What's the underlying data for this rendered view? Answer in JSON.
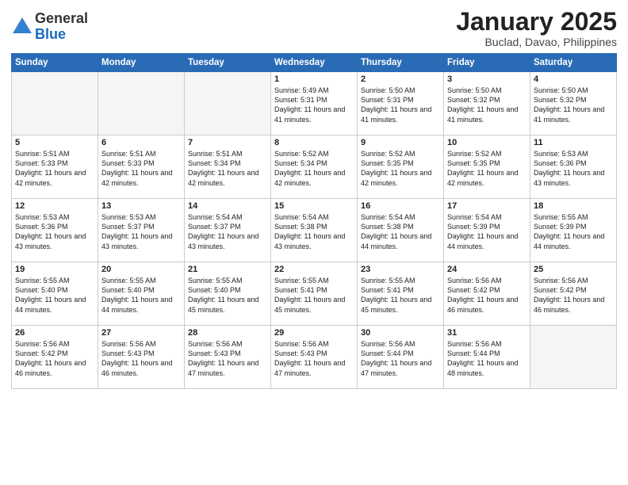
{
  "logo": {
    "general": "General",
    "blue": "Blue"
  },
  "title": "January 2025",
  "subtitle": "Buclad, Davao, Philippines",
  "headers": [
    "Sunday",
    "Monday",
    "Tuesday",
    "Wednesday",
    "Thursday",
    "Friday",
    "Saturday"
  ],
  "weeks": [
    [
      {
        "day": "",
        "empty": true
      },
      {
        "day": "",
        "empty": true
      },
      {
        "day": "",
        "empty": true
      },
      {
        "day": "1",
        "sunrise": "Sunrise: 5:49 AM",
        "sunset": "Sunset: 5:31 PM",
        "daylight": "Daylight: 11 hours and 41 minutes."
      },
      {
        "day": "2",
        "sunrise": "Sunrise: 5:50 AM",
        "sunset": "Sunset: 5:31 PM",
        "daylight": "Daylight: 11 hours and 41 minutes."
      },
      {
        "day": "3",
        "sunrise": "Sunrise: 5:50 AM",
        "sunset": "Sunset: 5:32 PM",
        "daylight": "Daylight: 11 hours and 41 minutes."
      },
      {
        "day": "4",
        "sunrise": "Sunrise: 5:50 AM",
        "sunset": "Sunset: 5:32 PM",
        "daylight": "Daylight: 11 hours and 41 minutes."
      }
    ],
    [
      {
        "day": "5",
        "sunrise": "Sunrise: 5:51 AM",
        "sunset": "Sunset: 5:33 PM",
        "daylight": "Daylight: 11 hours and 42 minutes."
      },
      {
        "day": "6",
        "sunrise": "Sunrise: 5:51 AM",
        "sunset": "Sunset: 5:33 PM",
        "daylight": "Daylight: 11 hours and 42 minutes."
      },
      {
        "day": "7",
        "sunrise": "Sunrise: 5:51 AM",
        "sunset": "Sunset: 5:34 PM",
        "daylight": "Daylight: 11 hours and 42 minutes."
      },
      {
        "day": "8",
        "sunrise": "Sunrise: 5:52 AM",
        "sunset": "Sunset: 5:34 PM",
        "daylight": "Daylight: 11 hours and 42 minutes."
      },
      {
        "day": "9",
        "sunrise": "Sunrise: 5:52 AM",
        "sunset": "Sunset: 5:35 PM",
        "daylight": "Daylight: 11 hours and 42 minutes."
      },
      {
        "day": "10",
        "sunrise": "Sunrise: 5:52 AM",
        "sunset": "Sunset: 5:35 PM",
        "daylight": "Daylight: 11 hours and 42 minutes."
      },
      {
        "day": "11",
        "sunrise": "Sunrise: 5:53 AM",
        "sunset": "Sunset: 5:36 PM",
        "daylight": "Daylight: 11 hours and 43 minutes."
      }
    ],
    [
      {
        "day": "12",
        "sunrise": "Sunrise: 5:53 AM",
        "sunset": "Sunset: 5:36 PM",
        "daylight": "Daylight: 11 hours and 43 minutes."
      },
      {
        "day": "13",
        "sunrise": "Sunrise: 5:53 AM",
        "sunset": "Sunset: 5:37 PM",
        "daylight": "Daylight: 11 hours and 43 minutes."
      },
      {
        "day": "14",
        "sunrise": "Sunrise: 5:54 AM",
        "sunset": "Sunset: 5:37 PM",
        "daylight": "Daylight: 11 hours and 43 minutes."
      },
      {
        "day": "15",
        "sunrise": "Sunrise: 5:54 AM",
        "sunset": "Sunset: 5:38 PM",
        "daylight": "Daylight: 11 hours and 43 minutes."
      },
      {
        "day": "16",
        "sunrise": "Sunrise: 5:54 AM",
        "sunset": "Sunset: 5:38 PM",
        "daylight": "Daylight: 11 hours and 44 minutes."
      },
      {
        "day": "17",
        "sunrise": "Sunrise: 5:54 AM",
        "sunset": "Sunset: 5:39 PM",
        "daylight": "Daylight: 11 hours and 44 minutes."
      },
      {
        "day": "18",
        "sunrise": "Sunrise: 5:55 AM",
        "sunset": "Sunset: 5:39 PM",
        "daylight": "Daylight: 11 hours and 44 minutes."
      }
    ],
    [
      {
        "day": "19",
        "sunrise": "Sunrise: 5:55 AM",
        "sunset": "Sunset: 5:40 PM",
        "daylight": "Daylight: 11 hours and 44 minutes."
      },
      {
        "day": "20",
        "sunrise": "Sunrise: 5:55 AM",
        "sunset": "Sunset: 5:40 PM",
        "daylight": "Daylight: 11 hours and 44 minutes."
      },
      {
        "day": "21",
        "sunrise": "Sunrise: 5:55 AM",
        "sunset": "Sunset: 5:40 PM",
        "daylight": "Daylight: 11 hours and 45 minutes."
      },
      {
        "day": "22",
        "sunrise": "Sunrise: 5:55 AM",
        "sunset": "Sunset: 5:41 PM",
        "daylight": "Daylight: 11 hours and 45 minutes."
      },
      {
        "day": "23",
        "sunrise": "Sunrise: 5:55 AM",
        "sunset": "Sunset: 5:41 PM",
        "daylight": "Daylight: 11 hours and 45 minutes."
      },
      {
        "day": "24",
        "sunrise": "Sunrise: 5:56 AM",
        "sunset": "Sunset: 5:42 PM",
        "daylight": "Daylight: 11 hours and 46 minutes."
      },
      {
        "day": "25",
        "sunrise": "Sunrise: 5:56 AM",
        "sunset": "Sunset: 5:42 PM",
        "daylight": "Daylight: 11 hours and 46 minutes."
      }
    ],
    [
      {
        "day": "26",
        "sunrise": "Sunrise: 5:56 AM",
        "sunset": "Sunset: 5:42 PM",
        "daylight": "Daylight: 11 hours and 46 minutes."
      },
      {
        "day": "27",
        "sunrise": "Sunrise: 5:56 AM",
        "sunset": "Sunset: 5:43 PM",
        "daylight": "Daylight: 11 hours and 46 minutes."
      },
      {
        "day": "28",
        "sunrise": "Sunrise: 5:56 AM",
        "sunset": "Sunset: 5:43 PM",
        "daylight": "Daylight: 11 hours and 47 minutes."
      },
      {
        "day": "29",
        "sunrise": "Sunrise: 5:56 AM",
        "sunset": "Sunset: 5:43 PM",
        "daylight": "Daylight: 11 hours and 47 minutes."
      },
      {
        "day": "30",
        "sunrise": "Sunrise: 5:56 AM",
        "sunset": "Sunset: 5:44 PM",
        "daylight": "Daylight: 11 hours and 47 minutes."
      },
      {
        "day": "31",
        "sunrise": "Sunrise: 5:56 AM",
        "sunset": "Sunset: 5:44 PM",
        "daylight": "Daylight: 11 hours and 48 minutes."
      },
      {
        "day": "",
        "empty": true
      }
    ]
  ]
}
